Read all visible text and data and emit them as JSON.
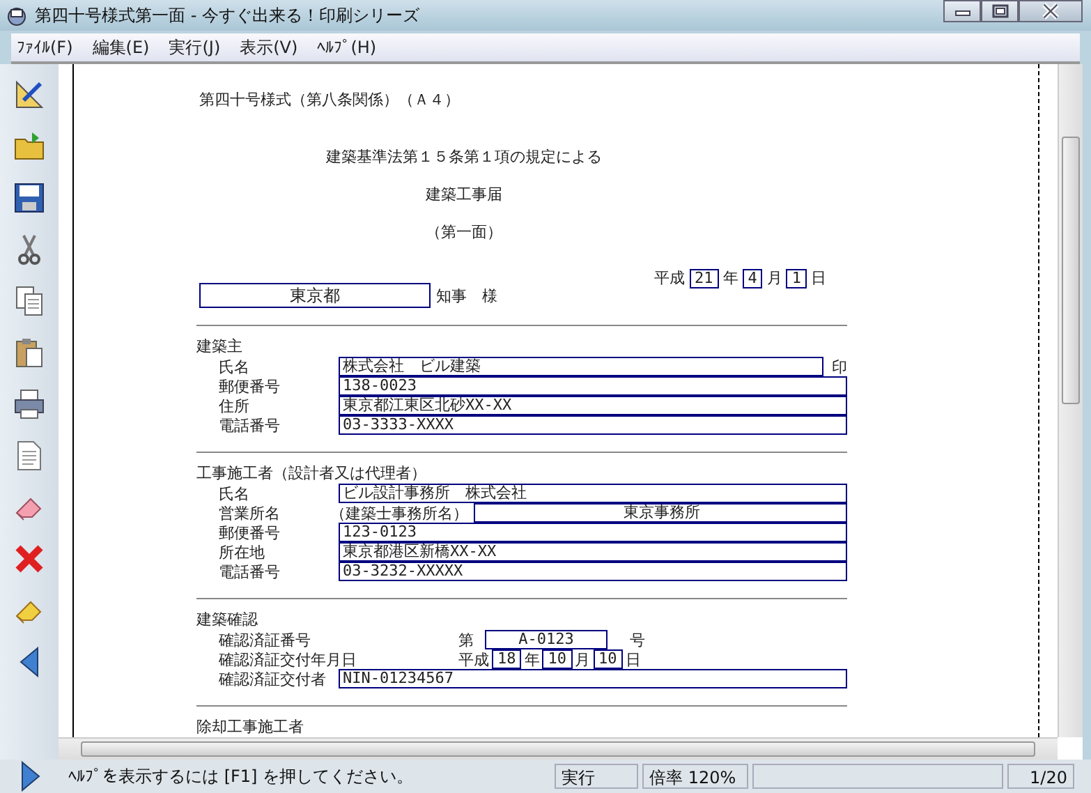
{
  "window": {
    "title": "第四十号様式第一面 - 今すぐ出来る！印刷シリーズ"
  },
  "menu": [
    "ﾌｧｲﾙ(F)",
    "編集(E)",
    "実行(J)",
    "表示(V)",
    "ﾍﾙﾌﾟ(H)"
  ],
  "document": {
    "form_no": "第四十号様式（第八条関係）（Ａ４）",
    "law_line": "建築基準法第１５条第１項の規定による",
    "title": "建築工事届",
    "face": "（第一面）",
    "date": {
      "era": "平成",
      "parts": [
        {
          "value": "21",
          "unit": "年"
        },
        {
          "value": "4",
          "unit": "月"
        },
        {
          "value": "1",
          "unit": "日"
        }
      ]
    },
    "governor": {
      "value": "東京都",
      "suffix": "知事　様"
    },
    "sections": [
      {
        "heading": "建築主",
        "rows": [
          {
            "kind": "line",
            "label": "氏名",
            "value": "株式会社　ビル建築",
            "suffix": "印"
          },
          {
            "kind": "line",
            "label": "郵便番号",
            "value": "138-0023"
          },
          {
            "kind": "line",
            "label": "住所",
            "value": "東京都江東区北砂XX-XX"
          },
          {
            "kind": "line",
            "label": "電話番号",
            "value": "03-3333-XXXX"
          }
        ]
      },
      {
        "heading": "工事施工者（設計者又は代理者）",
        "rows": [
          {
            "kind": "line",
            "label": "氏名",
            "value": "ビル設計事務所　株式会社"
          },
          {
            "kind": "office",
            "label": "営業所名",
            "sublabel": "（建築士事務所名）",
            "value": "東京事務所"
          },
          {
            "kind": "line",
            "label": "郵便番号",
            "value": "123-0123"
          },
          {
            "kind": "line",
            "label": "所在地",
            "value": "東京都港区新橋XX-XX"
          },
          {
            "kind": "line",
            "label": "電話番号",
            "value": "03-3232-XXXXX"
          }
        ]
      },
      {
        "heading": "建築確認",
        "rows": [
          {
            "kind": "certno",
            "label": "確認済証番号",
            "prefix": "第",
            "value": "A-0123",
            "suffix": "号"
          },
          {
            "kind": "date",
            "label": "確認済証交付年月日",
            "era": "平成",
            "parts": [
              {
                "value": "18",
                "unit": "年"
              },
              {
                "value": "10",
                "unit": "月"
              },
              {
                "value": "10",
                "unit": "日"
              }
            ]
          },
          {
            "kind": "line",
            "label": "確認済証交付者",
            "value": "NIN-01234567"
          }
        ]
      },
      {
        "heading": "除却工事施工者"
      }
    ]
  },
  "status_bar": {
    "help": "ﾍﾙﾌﾟを表示するには [F1] を押してください。",
    "mode": "実行",
    "zoom": "倍率 120%",
    "page": "1/20"
  }
}
